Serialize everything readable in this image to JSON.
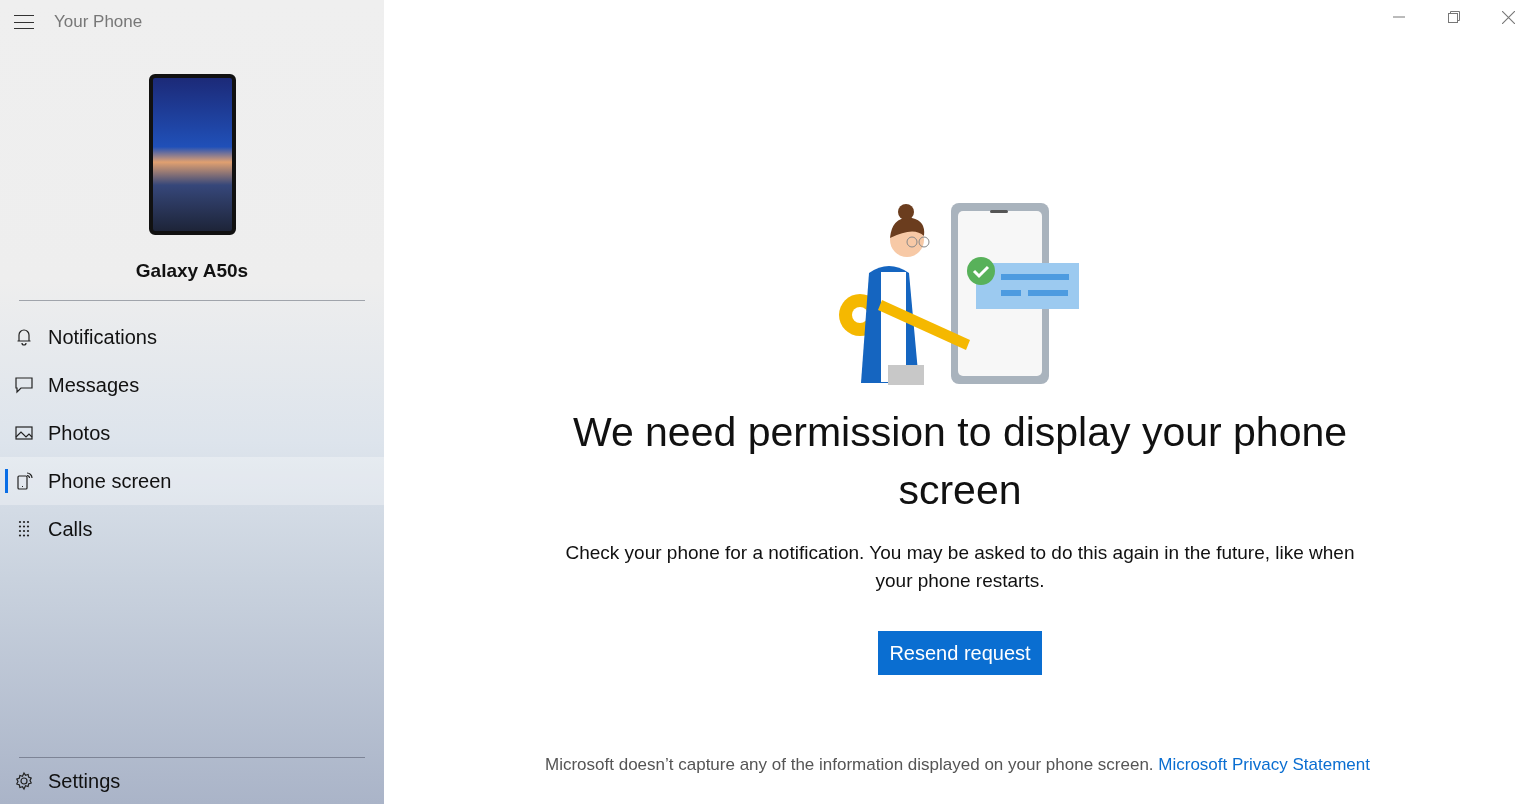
{
  "app_title": "Your Phone",
  "device": {
    "name": "Galaxy A50s"
  },
  "nav": [
    {
      "kind": "bell",
      "label": "Notifications",
      "selected": false
    },
    {
      "kind": "message",
      "label": "Messages",
      "selected": false
    },
    {
      "kind": "photo",
      "label": "Photos",
      "selected": false
    },
    {
      "kind": "phone",
      "label": "Phone screen",
      "selected": true
    },
    {
      "kind": "dialpad",
      "label": "Calls",
      "selected": false
    }
  ],
  "settings": {
    "label": "Settings"
  },
  "main": {
    "heading": "We need permission to display your phone screen",
    "body": "Check your phone for a notification. You may be asked to do this again in the future, like when your phone restarts.",
    "button": "Resend request",
    "footer": "Microsoft doesn’t capture any of the information displayed on your phone screen.",
    "footer_link": "Microsoft Privacy Statement"
  }
}
